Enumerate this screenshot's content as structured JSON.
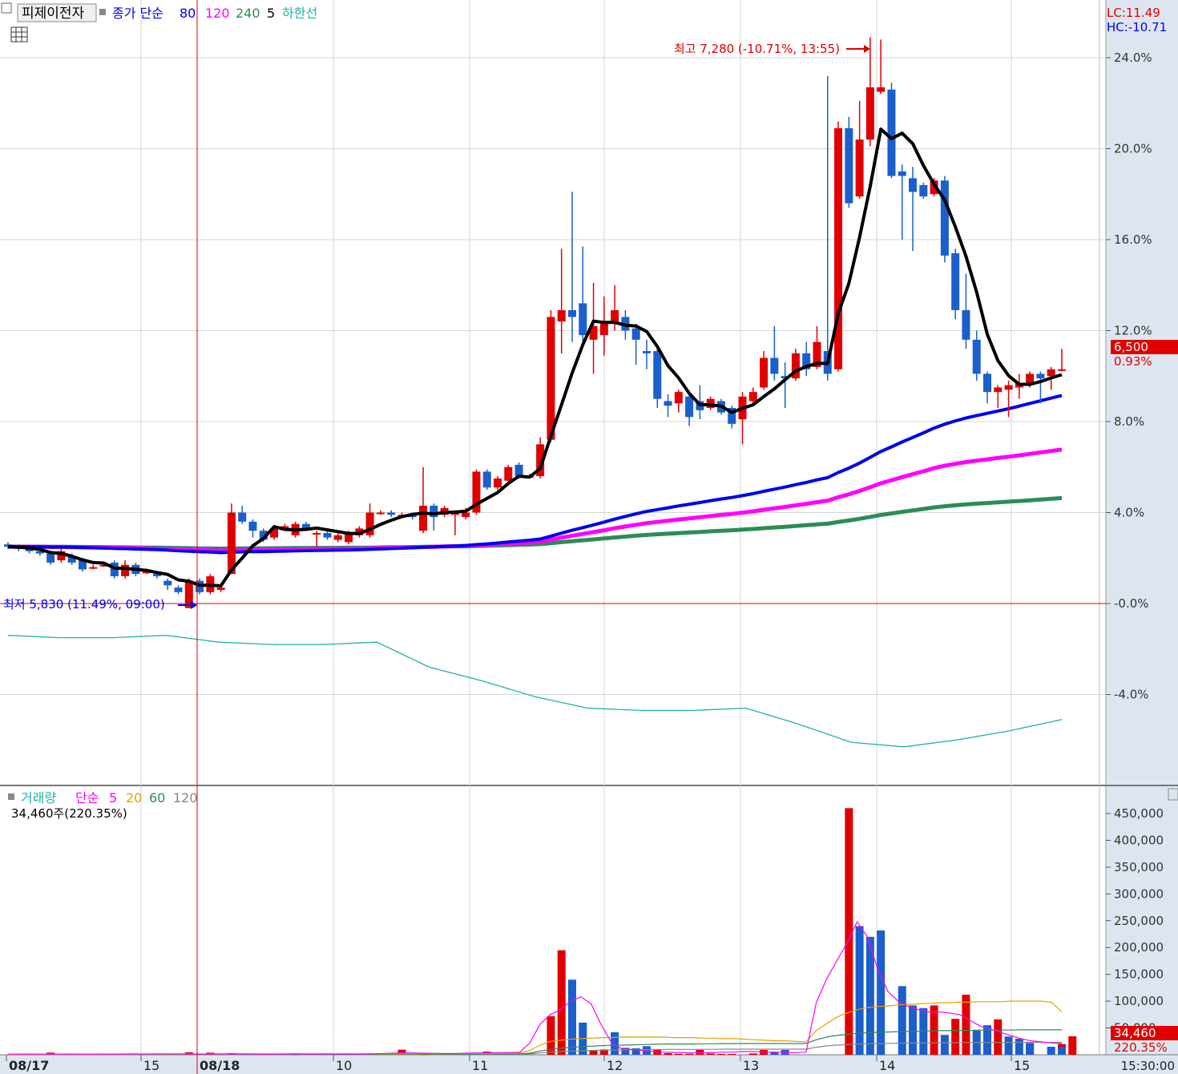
{
  "header": {
    "stock_name": "피제이전자",
    "ma_legend_prefix": "종가 단순",
    "ma_periods": [
      "80",
      "120",
      "240",
      "5"
    ],
    "ma_colors": [
      "#0000ee",
      "#ff00ff",
      "#2e8b57",
      "#000000"
    ],
    "envelope_label": "하한선",
    "envelope_color": "#20b2aa",
    "lc_text": "LC:11.49",
    "hc_text": "HC:-10.71",
    "table-icon": "grid-table-icon"
  },
  "price_panel": {
    "y_axis_ticks": [
      "24.0%",
      "20.0%",
      "16.0%",
      "12.0%",
      "8.0%",
      "4.0%",
      "-0.0%",
      "-4.0%"
    ],
    "current_price_label": "6,500",
    "current_change_label": "0.93%",
    "high_annotation": "최고 7,280 (-10.71%, 13:55)",
    "low_annotation": "최저 5,830 (11.49%, 09:00)"
  },
  "volume_panel": {
    "legend_title": "거래량",
    "legend_prefix": "단순",
    "ma_periods": [
      "5",
      "20",
      "60",
      "120"
    ],
    "ma_colors": [
      "#ff00ff",
      "#e6a000",
      "#2e8b57",
      "#888888"
    ],
    "current_volume_text": "34,460주(220.35%)",
    "y_axis_ticks": [
      "450,000",
      "400,000",
      "350,000",
      "300,000",
      "250,000",
      "200,000",
      "150,000",
      "100,000",
      "50,000"
    ],
    "current_volume_label": "34,460",
    "current_volume_pct_label": "220.35%"
  },
  "x_axis": {
    "labels": [
      "08/17",
      "15",
      "08/18",
      "10",
      "11",
      "12",
      "13",
      "14",
      "15"
    ],
    "right_time": "15:30:00"
  },
  "chart_data": {
    "type": "candlestick",
    "y_unit": "percent change from baseline (5,830)",
    "ylim": [
      -8,
      27
    ],
    "candles": [
      {
        "o": 2.6,
        "c": 2.5,
        "h": 2.7,
        "l": 2.4
      },
      {
        "o": 2.5,
        "c": 2.4,
        "h": 2.6,
        "l": 2.3
      },
      {
        "o": 2.4,
        "c": 2.3,
        "h": 2.5,
        "l": 2.2
      },
      {
        "o": 2.3,
        "c": 2.2,
        "h": 2.4,
        "l": 2.1
      },
      {
        "o": 2.2,
        "c": 1.8,
        "h": 2.3,
        "l": 1.7
      },
      {
        "o": 1.9,
        "c": 2.3,
        "h": 2.4,
        "l": 1.8
      },
      {
        "o": 2.1,
        "c": 1.8,
        "h": 2.2,
        "l": 1.7
      },
      {
        "o": 1.9,
        "c": 1.5,
        "h": 2.0,
        "l": 1.4
      },
      {
        "o": 1.6,
        "c": 1.6,
        "h": 1.7,
        "l": 1.5
      },
      {
        "o": 1.7,
        "c": 1.7,
        "h": 1.8,
        "l": 1.6
      },
      {
        "o": 1.8,
        "c": 1.2,
        "h": 1.9,
        "l": 1.1
      },
      {
        "o": 1.2,
        "c": 1.7,
        "h": 1.9,
        "l": 1.1
      },
      {
        "o": 1.7,
        "c": 1.3,
        "h": 1.8,
        "l": 1.2
      },
      {
        "o": 1.4,
        "c": 1.4,
        "h": 1.5,
        "l": 1.3
      },
      {
        "o": 1.3,
        "c": 1.2,
        "h": 1.4,
        "l": 1.1
      },
      {
        "o": 1.0,
        "c": 0.8,
        "h": 1.1,
        "l": 0.6
      },
      {
        "o": 0.7,
        "c": 0.5,
        "h": 0.8,
        "l": 0.4
      },
      {
        "o": -0.2,
        "c": 1.0,
        "h": 1.1,
        "l": -0.2
      },
      {
        "o": 1.0,
        "c": 0.5,
        "h": 1.1,
        "l": 0.4
      },
      {
        "o": 0.5,
        "c": 1.2,
        "h": 1.3,
        "l": 0.4
      },
      {
        "o": 0.6,
        "c": 0.7,
        "h": 0.8,
        "l": 0.5
      },
      {
        "o": 1.3,
        "c": 4.0,
        "h": 4.4,
        "l": 1.3
      },
      {
        "o": 4.0,
        "c": 3.6,
        "h": 4.3,
        "l": 3.5
      },
      {
        "o": 3.6,
        "c": 3.2,
        "h": 3.7,
        "l": 2.9
      },
      {
        "o": 3.2,
        "c": 2.8,
        "h": 3.3,
        "l": 2.7
      },
      {
        "o": 2.9,
        "c": 3.3,
        "h": 3.4,
        "l": 2.8
      },
      {
        "o": 3.4,
        "c": 3.4,
        "h": 3.5,
        "l": 3.3
      },
      {
        "o": 3.0,
        "c": 3.5,
        "h": 3.6,
        "l": 2.9
      },
      {
        "o": 3.5,
        "c": 3.3,
        "h": 3.6,
        "l": 3.2
      },
      {
        "o": 3.1,
        "c": 3.1,
        "h": 3.2,
        "l": 2.5
      },
      {
        "o": 3.1,
        "c": 2.9,
        "h": 3.2,
        "l": 2.8
      },
      {
        "o": 2.8,
        "c": 3.0,
        "h": 3.1,
        "l": 2.7
      },
      {
        "o": 2.7,
        "c": 3.1,
        "h": 3.2,
        "l": 2.6
      },
      {
        "o": 3.0,
        "c": 3.3,
        "h": 3.4,
        "l": 2.9
      },
      {
        "o": 3.0,
        "c": 4.0,
        "h": 4.4,
        "l": 2.9
      },
      {
        "o": 4.0,
        "c": 4.0,
        "h": 4.1,
        "l": 3.9
      },
      {
        "o": 4.0,
        "c": 3.9,
        "h": 4.1,
        "l": 3.8
      },
      {
        "o": 3.9,
        "c": 3.9,
        "h": 4.0,
        "l": 3.8
      },
      {
        "o": 3.9,
        "c": 3.8,
        "h": 4.0,
        "l": 3.7
      },
      {
        "o": 3.2,
        "c": 4.3,
        "h": 6.0,
        "l": 3.1
      },
      {
        "o": 4.3,
        "c": 3.8,
        "h": 4.4,
        "l": 3.2
      },
      {
        "o": 3.9,
        "c": 4.2,
        "h": 4.3,
        "l": 3.8
      },
      {
        "o": 3.9,
        "c": 4.0,
        "h": 4.1,
        "l": 3.0
      },
      {
        "o": 3.8,
        "c": 4.0,
        "h": 4.2,
        "l": 3.7
      },
      {
        "o": 4.0,
        "c": 5.8,
        "h": 5.9,
        "l": 3.9
      },
      {
        "o": 5.8,
        "c": 5.1,
        "h": 5.9,
        "l": 5.0
      },
      {
        "o": 5.1,
        "c": 5.5,
        "h": 5.6,
        "l": 5.0
      },
      {
        "o": 5.4,
        "c": 6.0,
        "h": 6.1,
        "l": 5.3
      },
      {
        "o": 6.1,
        "c": 5.6,
        "h": 6.2,
        "l": 5.5
      },
      {
        "o": 5.6,
        "c": 5.6,
        "h": 5.7,
        "l": 5.5
      },
      {
        "o": 5.6,
        "c": 7.0,
        "h": 7.3,
        "l": 5.5
      },
      {
        "o": 7.2,
        "c": 12.6,
        "h": 12.9,
        "l": 7.1
      },
      {
        "o": 12.4,
        "c": 12.9,
        "h": 15.6,
        "l": 11.0
      },
      {
        "o": 12.9,
        "c": 12.6,
        "h": 18.1,
        "l": 11.5
      },
      {
        "o": 13.2,
        "c": 11.8,
        "h": 15.7,
        "l": 11.3
      },
      {
        "o": 11.6,
        "c": 12.2,
        "h": 14.1,
        "l": 10.1
      },
      {
        "o": 11.8,
        "c": 12.3,
        "h": 13.5,
        "l": 10.9
      },
      {
        "o": 12.3,
        "c": 12.9,
        "h": 14.0,
        "l": 12.0
      },
      {
        "o": 12.6,
        "c": 12.0,
        "h": 12.9,
        "l": 11.6
      },
      {
        "o": 12.1,
        "c": 11.6,
        "h": 12.3,
        "l": 10.5
      },
      {
        "o": 11.1,
        "c": 11.0,
        "h": 11.6,
        "l": 10.3
      },
      {
        "o": 11.1,
        "c": 9.0,
        "h": 11.3,
        "l": 8.6
      },
      {
        "o": 8.9,
        "c": 8.7,
        "h": 9.2,
        "l": 8.2
      },
      {
        "o": 8.8,
        "c": 9.3,
        "h": 9.4,
        "l": 8.4
      },
      {
        "o": 9.1,
        "c": 8.2,
        "h": 9.2,
        "l": 7.8
      },
      {
        "o": 8.9,
        "c": 8.5,
        "h": 9.6,
        "l": 8.1
      },
      {
        "o": 8.6,
        "c": 9.0,
        "h": 9.1,
        "l": 8.5
      },
      {
        "o": 8.9,
        "c": 8.4,
        "h": 9.0,
        "l": 8.3
      },
      {
        "o": 8.6,
        "c": 7.9,
        "h": 8.7,
        "l": 7.7
      },
      {
        "o": 8.1,
        "c": 9.1,
        "h": 9.3,
        "l": 7.0
      },
      {
        "o": 8.9,
        "c": 9.3,
        "h": 9.5,
        "l": 8.8
      },
      {
        "o": 9.5,
        "c": 10.8,
        "h": 11.1,
        "l": 9.4
      },
      {
        "o": 10.8,
        "c": 10.1,
        "h": 12.2,
        "l": 9.8
      },
      {
        "o": 10.0,
        "c": 9.9,
        "h": 10.6,
        "l": 8.6
      },
      {
        "o": 9.9,
        "c": 11.0,
        "h": 11.2,
        "l": 9.8
      },
      {
        "o": 11.0,
        "c": 10.3,
        "h": 11.5,
        "l": 10.0
      },
      {
        "o": 10.4,
        "c": 11.5,
        "h": 12.2,
        "l": 10.3
      },
      {
        "o": 11.1,
        "c": 10.1,
        "h": 23.2,
        "l": 9.8
      },
      {
        "o": 10.3,
        "c": 20.9,
        "h": 21.2,
        "l": 10.2
      },
      {
        "o": 20.9,
        "c": 17.6,
        "h": 21.4,
        "l": 17.4
      },
      {
        "o": 17.9,
        "c": 20.4,
        "h": 22.1,
        "l": 17.8
      },
      {
        "o": 20.4,
        "c": 22.7,
        "h": 24.9,
        "l": 20.1
      },
      {
        "o": 22.5,
        "c": 22.7,
        "h": 24.8,
        "l": 22.4
      },
      {
        "o": 22.6,
        "c": 18.8,
        "h": 22.9,
        "l": 18.7
      },
      {
        "o": 19.0,
        "c": 18.8,
        "h": 19.3,
        "l": 16.0
      },
      {
        "o": 18.7,
        "c": 18.1,
        "h": 19.2,
        "l": 15.5
      },
      {
        "o": 18.4,
        "c": 17.9,
        "h": 18.5,
        "l": 17.8
      },
      {
        "o": 18.0,
        "c": 18.6,
        "h": 18.7,
        "l": 17.9
      },
      {
        "o": 18.6,
        "c": 15.3,
        "h": 18.8,
        "l": 15.0
      },
      {
        "o": 15.4,
        "c": 12.9,
        "h": 15.6,
        "l": 12.5
      },
      {
        "o": 12.9,
        "c": 11.6,
        "h": 14.5,
        "l": 11.2
      },
      {
        "o": 11.6,
        "c": 10.1,
        "h": 12.0,
        "l": 9.8
      },
      {
        "o": 10.1,
        "c": 9.3,
        "h": 10.2,
        "l": 8.8
      },
      {
        "o": 9.3,
        "c": 9.5,
        "h": 9.6,
        "l": 8.6
      },
      {
        "o": 9.4,
        "c": 9.6,
        "h": 9.8,
        "l": 8.2
      },
      {
        "o": 9.5,
        "c": 9.7,
        "h": 10.1,
        "l": 9.0
      },
      {
        "o": 9.6,
        "c": 10.1,
        "h": 10.2,
        "l": 9.5
      },
      {
        "o": 10.1,
        "c": 9.9,
        "h": 10.2,
        "l": 8.8
      },
      {
        "o": 10.0,
        "c": 10.3,
        "h": 10.4,
        "l": 9.4
      },
      {
        "o": 10.3,
        "c": 10.3,
        "h": 11.2,
        "l": 10.2
      }
    ],
    "envelope_lower": [
      -1.4,
      -1.5,
      -1.5,
      -1.4,
      -1.7,
      -1.8,
      -1.8,
      -1.7,
      -2.8,
      -3.4,
      -4.1,
      -4.6,
      -4.7,
      -4.7,
      -4.6,
      -5.3,
      -6.1,
      -6.3,
      -6.0,
      -5.6,
      -5.1
    ],
    "volume_ylim": [
      0,
      475000
    ],
    "volume_up": [
      0,
      0,
      0,
      0,
      4000,
      0,
      1800,
      0,
      0,
      0,
      0,
      0,
      0,
      0,
      0,
      0,
      0,
      4500,
      0,
      3800,
      1400,
      3000,
      0,
      1200,
      1200,
      0,
      900,
      700,
      1400,
      0,
      0,
      0,
      0,
      0,
      0,
      0,
      0,
      9500,
      0,
      700,
      0,
      0,
      0,
      0,
      0,
      6000,
      0,
      0,
      0,
      0,
      0,
      72000,
      195000,
      0,
      12000,
      9000,
      10000,
      0,
      0,
      0,
      0,
      9000,
      3000,
      2000,
      2000,
      9000,
      2500,
      1500,
      1500,
      0,
      2500,
      9000,
      0,
      0,
      0,
      0,
      0,
      0,
      0,
      460000,
      0,
      0,
      0,
      0,
      0,
      0,
      0,
      92000,
      0,
      67000,
      112000,
      0,
      0,
      66000,
      0,
      0,
      19000,
      0,
      0,
      20000,
      34460
    ],
    "volume_down": [
      0,
      0,
      0,
      0,
      0,
      0,
      0,
      0,
      0,
      0,
      0,
      0,
      0,
      0,
      0,
      0,
      0,
      0,
      0,
      0,
      0,
      0,
      0,
      0,
      0,
      0,
      0,
      0,
      0,
      0,
      0,
      0,
      0,
      0,
      0,
      0,
      0,
      0,
      0,
      0,
      0,
      0,
      0,
      0,
      0,
      0,
      0,
      0,
      0,
      0,
      0,
      0,
      0,
      140000,
      60000,
      0,
      0,
      42000,
      13000,
      12000,
      16000,
      0,
      0,
      0,
      0,
      0,
      0,
      0,
      0,
      0,
      0,
      0,
      5000,
      9000,
      0,
      0,
      0,
      0,
      0,
      0,
      240000,
      220000,
      232000,
      0,
      128000,
      92000,
      87000,
      0,
      37000,
      0,
      0,
      45000,
      55000,
      0,
      34000,
      30000,
      22000,
      0,
      15000,
      15000,
      0,
      0,
      0,
      0
    ],
    "volume_ma5": [
      1200,
      1200,
      1300,
      1200,
      1500,
      1200,
      1300,
      1200,
      1100,
      1300,
      1200,
      1400,
      1600,
      1400,
      1500,
      1700,
      1500,
      1600,
      1500,
      1400,
      1600,
      1500,
      1400,
      1600,
      1500,
      1300,
      1400,
      1500,
      1600,
      1400,
      1400,
      1500,
      1400,
      1500,
      1400,
      1500,
      1900,
      2600,
      3200,
      3400,
      3200,
      2900,
      2500,
      2200,
      2500,
      3300,
      3500,
      3800,
      4100,
      4200,
      4500,
      22000,
      57000,
      75000,
      84000,
      100000,
      108000,
      95000,
      55000,
      22000,
      11000,
      10000,
      8000,
      6000,
      5000,
      4500,
      4000,
      3500,
      3800,
      4000,
      5000,
      5000,
      6000,
      6000,
      5000,
      5000,
      4000,
      4000,
      5000,
      97000,
      141000,
      175000,
      208000,
      248000,
      220000,
      160000,
      118000,
      100000,
      90000,
      84000,
      80000,
      80000,
      78000,
      75000,
      64000,
      54000,
      48000,
      42000,
      36000,
      30000,
      26000,
      24000,
      22000,
      21000
    ],
    "volume_ma20": [
      900,
      900,
      950,
      950,
      1000,
      1000,
      1050,
      1050,
      1100,
      1100,
      1150,
      1150,
      1200,
      1200,
      1250,
      1250,
      1300,
      1300,
      1350,
      1350,
      1400,
      1400,
      1450,
      1450,
      1500,
      1500,
      1550,
      1550,
      1600,
      1600,
      1650,
      1650,
      1700,
      1700,
      1750,
      1750,
      1800,
      1800,
      1850,
      1850,
      1900,
      2000,
      2100,
      2200,
      2300,
      2400,
      2500,
      2600,
      2700,
      2800,
      3000,
      8000,
      18000,
      25000,
      27000,
      29000,
      30000,
      31000,
      32000,
      32000,
      33000,
      33000,
      33000,
      33000,
      33000,
      32000,
      32000,
      32000,
      31000,
      31000,
      30000,
      30000,
      29000,
      28000,
      27000,
      26000,
      26000,
      25000,
      24000,
      45000,
      58000,
      70000,
      78000,
      84000,
      88000,
      90000,
      91000,
      93000,
      94000,
      95000,
      96000,
      97000,
      97000,
      98000,
      98000,
      99000,
      99000,
      99000,
      100000,
      100000,
      100000,
      100000,
      98000,
      80000
    ],
    "volume_ma60": [
      500,
      500,
      520,
      520,
      540,
      540,
      560,
      560,
      580,
      580,
      600,
      600,
      620,
      620,
      640,
      640,
      660,
      660,
      680,
      680,
      700,
      700,
      720,
      720,
      740,
      740,
      760,
      760,
      780,
      780,
      800,
      800,
      820,
      820,
      840,
      840,
      860,
      860,
      880,
      880,
      900,
      950,
      1000,
      1050,
      1100,
      1150,
      1200,
      1250,
      1300,
      1350,
      1400,
      3000,
      7000,
      10000,
      12000,
      14000,
      15000,
      16000,
      17000,
      17500,
      18000,
      18500,
      19000,
      19500,
      20000,
      20000,
      20000,
      20000,
      20500,
      20500,
      21000,
      21000,
      21000,
      21000,
      21000,
      21000,
      21000,
      21000,
      21000,
      28000,
      33000,
      36000,
      38000,
      40000,
      41000,
      42000,
      42500,
      43000,
      43500,
      44000,
      44500,
      45000,
      45000,
      45500,
      45500,
      46000,
      46000,
      46000,
      46000,
      46500,
      46500,
      46500,
      46500,
      46500
    ],
    "volume_ma120": [
      300,
      300,
      310,
      310,
      320,
      320,
      330,
      330,
      340,
      340,
      350,
      350,
      360,
      360,
      370,
      370,
      380,
      380,
      390,
      390,
      400,
      400,
      410,
      410,
      420,
      420,
      430,
      430,
      440,
      440,
      450,
      450,
      460,
      460,
      470,
      470,
      480,
      480,
      490,
      490,
      500,
      520,
      540,
      560,
      580,
      600,
      620,
      640,
      660,
      680,
      700,
      1500,
      3500,
      5000,
      6000,
      7000,
      7500,
      8000,
      8500,
      8800,
      9000,
      9300,
      9500,
      9700,
      10000,
      10000,
      10000,
      10000,
      10200,
      10200,
      10500,
      10500,
      10500,
      10500,
      10500,
      10500,
      10500,
      10500,
      10500,
      14000,
      16500,
      18000,
      19000,
      20000,
      20500,
      21000,
      21200,
      21500,
      21800,
      22000,
      22200,
      22500,
      22500,
      22700,
      22700,
      23000,
      23000,
      23000,
      23000,
      23200,
      23200,
      23200,
      23200,
      23200
    ]
  }
}
